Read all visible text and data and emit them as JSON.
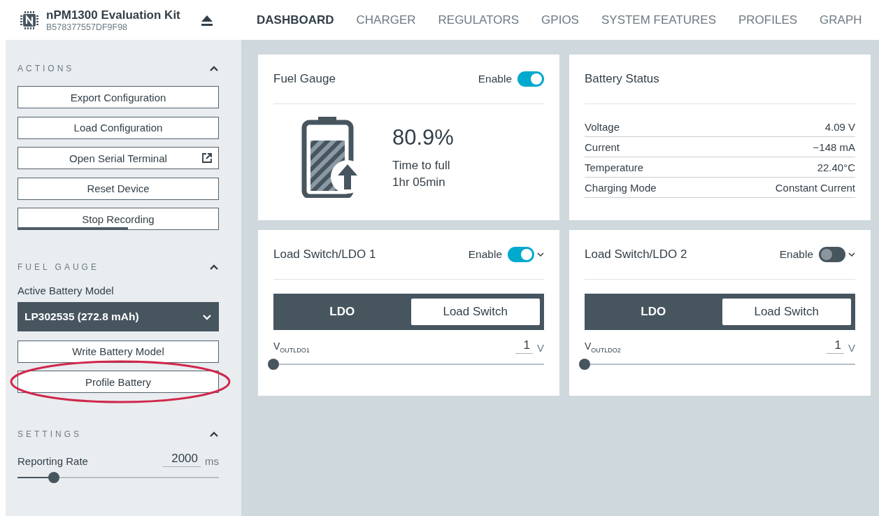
{
  "device": {
    "name": "nPM1300 Evaluation Kit",
    "serial": "B578377557DF9F98"
  },
  "nav": [
    {
      "label": "DASHBOARD",
      "selected": true
    },
    {
      "label": "CHARGER",
      "selected": false
    },
    {
      "label": "REGULATORS",
      "selected": false
    },
    {
      "label": "GPIOS",
      "selected": false
    },
    {
      "label": "SYSTEM FEATURES",
      "selected": false
    },
    {
      "label": "PROFILES",
      "selected": false
    },
    {
      "label": "GRAPH",
      "selected": false
    }
  ],
  "sidebar": {
    "actions": {
      "title": "ACTIONS",
      "expanded": true,
      "buttons": [
        {
          "label": "Export Configuration",
          "external": false
        },
        {
          "label": "Load Configuration",
          "external": false
        },
        {
          "label": "Open Serial Terminal",
          "external": true
        },
        {
          "label": "Reset Device",
          "external": false
        },
        {
          "label": "Stop Recording",
          "external": false,
          "level": 0.55
        }
      ]
    },
    "fuel_gauge": {
      "title": "FUEL GAUGE",
      "expanded": true,
      "model_label": "Active Battery Model",
      "model_value": "LP302535 (272.8 mAh)",
      "buttons": [
        {
          "label": "Write Battery Model",
          "highlighted": false
        },
        {
          "label": "Profile Battery",
          "highlighted": true
        }
      ]
    },
    "settings": {
      "title": "SETTINGS",
      "expanded": true,
      "rate_label": "Reporting Rate",
      "rate_value": "2000",
      "rate_unit": "ms",
      "level": 0.18
    }
  },
  "fuel_gauge_card": {
    "title": "Fuel Gauge",
    "enable_label": "Enable",
    "on": true,
    "percent": "80.9%",
    "time_label": "Time to full",
    "time_value": "1hr 05min"
  },
  "battery_status": {
    "title": "Battery Status",
    "rows": [
      {
        "label": "Voltage",
        "value": "4.09 V"
      },
      {
        "label": "Current",
        "value": "−148 mA"
      },
      {
        "label": "Temperature",
        "value": "22.40°C"
      },
      {
        "label": "Charging Mode",
        "value": "Constant Current"
      }
    ]
  },
  "load_switches": [
    {
      "title": "Load Switch/LDO 1",
      "enable_label": "Enable",
      "on": true,
      "modes": [
        {
          "label": "LDO",
          "selected": false
        },
        {
          "label": "Load Switch",
          "selected": true
        }
      ],
      "vout_label": "V$_{OUTLDO1}$",
      "vout_value": "1",
      "vout_unit": "V",
      "level": 0
    },
    {
      "title": "Load Switch/LDO 2",
      "enable_label": "Enable",
      "on": false,
      "modes": [
        {
          "label": "LDO",
          "selected": false
        },
        {
          "label": "Load Switch",
          "selected": true
        }
      ],
      "vout_label": "V$_{OUTLDO2}$",
      "vout_value": "1",
      "vout_unit": "V",
      "level": 0
    }
  ]
}
